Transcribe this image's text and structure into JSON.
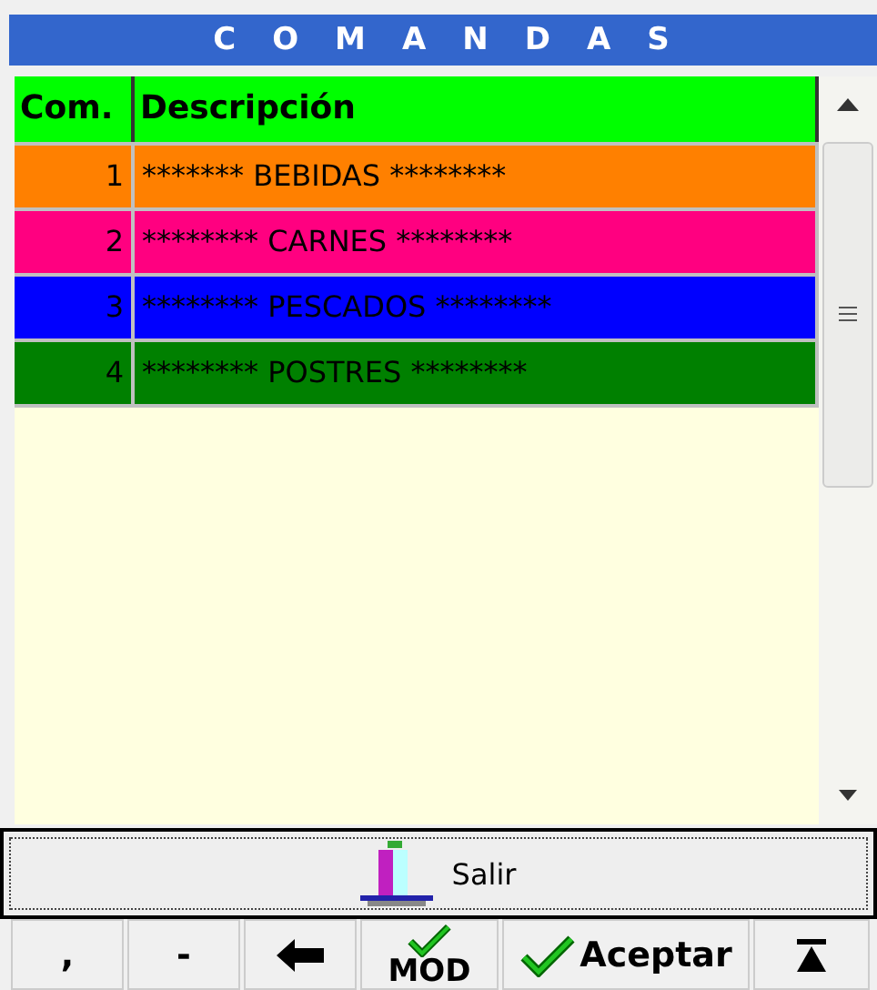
{
  "title": "COMANDAS",
  "table": {
    "columns": [
      "Com.",
      "Descripción"
    ],
    "rows": [
      {
        "number": "1",
        "description": "******* BEBIDAS ********",
        "color": "#ff8000"
      },
      {
        "number": "2",
        "description": "******** CARNES ********",
        "color": "#ff0080"
      },
      {
        "number": "3",
        "description": "******** PESCADOS ********",
        "color": "#0000ff"
      },
      {
        "number": "4",
        "description": "******** POSTRES ********",
        "color": "#008000"
      }
    ]
  },
  "exit_button": {
    "label": "Salir"
  },
  "keys": [
    {
      "kind": "text",
      "label": ","
    },
    {
      "kind": "text",
      "label": "-"
    },
    {
      "kind": "back"
    },
    {
      "kind": "mod",
      "label": "MOD"
    },
    {
      "kind": "accept",
      "label": "Aceptar"
    },
    {
      "kind": "top"
    }
  ]
}
